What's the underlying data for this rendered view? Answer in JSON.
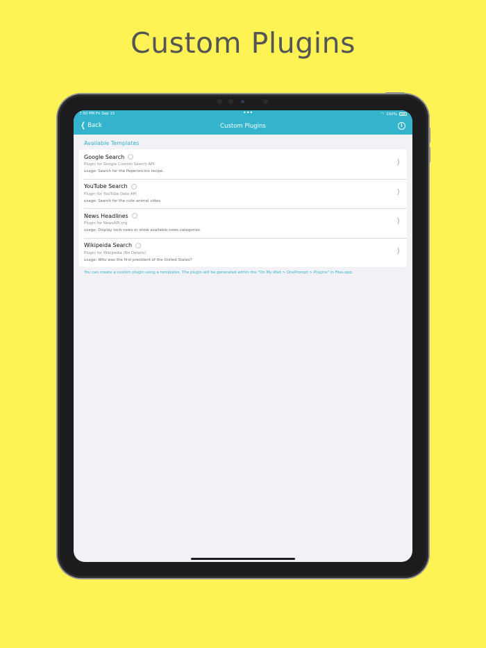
{
  "headline": "Custom Plugins",
  "status_bar": {
    "time": "7:50 PM   Fri Sep 15",
    "battery": "100%"
  },
  "nav": {
    "back_label": "Back",
    "title": "Custom Plugins"
  },
  "section_header": "Available Templates",
  "templates": [
    {
      "name": "Google Search",
      "description": "Plugin for Google Custom Search API",
      "usage": "usage: Search for the Peperoncino recipe."
    },
    {
      "name": "YouTube Search",
      "description": "Plugin for YouTube Data API",
      "usage": "usage: Search for the cute animal video."
    },
    {
      "name": "News Headlines",
      "description": "Plugin for NewsAPI.org",
      "usage": "usage: Display tech news or show available news categories."
    },
    {
      "name": "Wikipeida Search",
      "description": "Plugin for Wikipedia (No Details)",
      "usage": "usage: Who was the first president of the United States?"
    }
  ],
  "footer_note": "You can create a custom plugin using a templates. The plugin will be generated within the \"On My iPad > OnePrompt > Plugins\" in Files.app.",
  "colors": {
    "background": "#fff254",
    "accent": "#33b4cc",
    "screen_background": "#f1f1f6"
  },
  "icons": [
    "wifi-icon",
    "battery-icon",
    "chevron-left-icon",
    "info-icon",
    "chevron-right-icon"
  ]
}
